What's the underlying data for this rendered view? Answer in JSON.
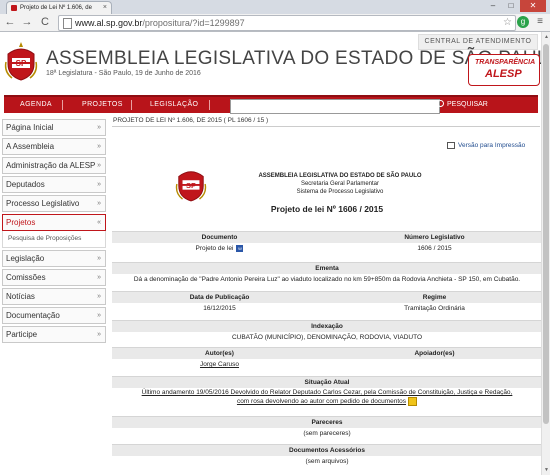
{
  "browser": {
    "tab_title": "Projeto de Lei Nº 1.606, de",
    "tab_close": "×",
    "url_host": "www.al.sp.gov.br",
    "url_rest": "/propositura/?id=1299897",
    "back": "←",
    "forward": "→",
    "reload": "C",
    "star": "☆",
    "menu": "≡",
    "win_min": "–",
    "win_max": "□",
    "win_close": "✕",
    "ext_icon": "g"
  },
  "header": {
    "central": "CENTRAL DE ATENDIMENTO",
    "title": "ASSEMBLEIA LEGISLATIVA DO ESTADO DE SÃO PAULO",
    "subtitle": "18ª Legislatura - São Paulo, 19 de Junho de 2016",
    "transparencia_1": "TRANSPARÊNCIA",
    "transparencia_2": "ALESP"
  },
  "nav": {
    "agenda": "AGENDA",
    "projetos": "PROJETOS",
    "legislacao": "LEGISLAÇÃO",
    "search_placeholder": "",
    "search_btn": "PESQUISAR"
  },
  "sidebar": {
    "items": [
      {
        "label": "Página Inicial"
      },
      {
        "label": "A Assembleia"
      },
      {
        "label": "Administração da ALESP"
      },
      {
        "label": "Deputados"
      },
      {
        "label": "Processo Legislativo"
      },
      {
        "label": "Projetos"
      },
      {
        "label": "Legislação"
      },
      {
        "label": "Comissões"
      },
      {
        "label": "Notícias"
      },
      {
        "label": "Documentação"
      },
      {
        "label": "Participe"
      }
    ],
    "sub_item": "Pesquisa de Proposições",
    "chev_down": "»",
    "chev_up": "«"
  },
  "content": {
    "breadcrumb": "PROJETO DE LEI Nº 1.606, DE 2015 ( PL 1606 / 15 )",
    "print": "Versão para Impressão",
    "doc_head_1": "ASSEMBLEIA LEGISLATIVA DO ESTADO DE SÃO PAULO",
    "doc_head_2": "Secretaria Geral Parlamentar",
    "doc_head_3": "Sistema de Processo Legislativo",
    "pl_title": "Projeto de lei  Nº  1606 / 2015",
    "documento_h": "Documento",
    "documento_v": "Projeto de lei",
    "numero_h": "Número Legislativo",
    "numero_v": "1606 / 2015",
    "ementa_h": "Ementa",
    "ementa_v": "Dá a denominação de \"Padre Antonio Pereira Luz\" ao viaduto localizado no km 59+850m da Rodovia Anchieta - SP 150, em Cubatão.",
    "data_h": "Data de Publicação",
    "data_v": "16/12/2015",
    "regime_h": "Regime",
    "regime_v": "Tramitação Ordinária",
    "indexacao_h": "Indexação",
    "indexacao_v": "CUBATÃO (MUNICÍPIO), DENOMINAÇÃO, RODOVIA, VIADUTO",
    "autor_h": "Autor(es)",
    "autor_v": "Jorge Caruso",
    "apoiador_h": "Apoiador(es)",
    "situacao_h": "Situação Atual",
    "situacao_v1": "Último andamento 19/05/2016 Devolvido do Relator Deputado Carlos Cezar, pela Comissão de Constituição, Justiça e Redação,",
    "situacao_v2": "com rosa devolvendo ao autor com pedido de documentos",
    "pareceres_h": "Pareceres",
    "pareceres_v": "(sem pareceres)",
    "docs_h": "Documentos Acessórios",
    "docs_v": "(sem arquivos)"
  }
}
